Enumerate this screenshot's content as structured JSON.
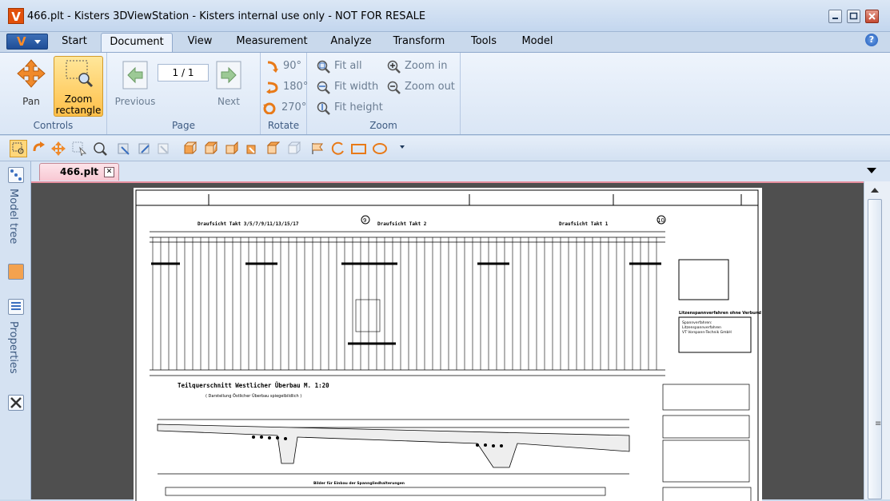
{
  "window": {
    "title": "466.plt - Kisters 3DViewStation - Kisters internal use only - NOT FOR RESALE",
    "logo": "V"
  },
  "app_menu": {
    "label": "V"
  },
  "tabs": [
    "Start",
    "Document",
    "View",
    "Measurement",
    "Analyze",
    "Transform",
    "Tools",
    "Model"
  ],
  "active_tab": "Document",
  "ribbon": {
    "controls": {
      "label": "Controls",
      "pan": "Pan",
      "zoom_rect_1": "Zoom",
      "zoom_rect_2": "rectangle"
    },
    "page": {
      "label": "Page",
      "previous": "Previous",
      "next": "Next",
      "current": "1 / 1"
    },
    "rotate": {
      "label": "Rotate",
      "r90": "90°",
      "r180": "180°",
      "r270": "270°"
    },
    "zoom": {
      "label": "Zoom",
      "fit_all": "Fit all",
      "fit_width": "Fit width",
      "fit_height": "Fit height",
      "zoom_in": "Zoom in",
      "zoom_out": "Zoom out"
    }
  },
  "sidebar": {
    "model_tree": "Model tree",
    "properties": "Properties"
  },
  "document_tab": {
    "name": "466.plt"
  },
  "drawing": {
    "title_main": "Teilquerschnitt Westlicher Überbau M. 1:20",
    "subtitle": "( Darstellung Östlicher Überbau spiegelbildlich )",
    "header_1": "Draufsicht Takt 3/5/7/9/11/13/15/17",
    "header_2": "Draufsicht Takt 2",
    "header_3": "Draufsicht Takt 1",
    "axis_a": "9",
    "axis_b": "10",
    "side_heading": "Litzenspannverfahren ohne Verbund",
    "side_text_1": "Spannverfahren:",
    "side_text_2": "Litzenspannverfahren",
    "side_text_3": "VT Vorspann-Technik GmbH",
    "caption": "Bilder für Einbau der Spanngliedhalterungen"
  },
  "colors": {
    "accent": "#e2500b",
    "ribbon_bg": "#dae6f5",
    "viewport_bg": "#4f4f4f"
  }
}
